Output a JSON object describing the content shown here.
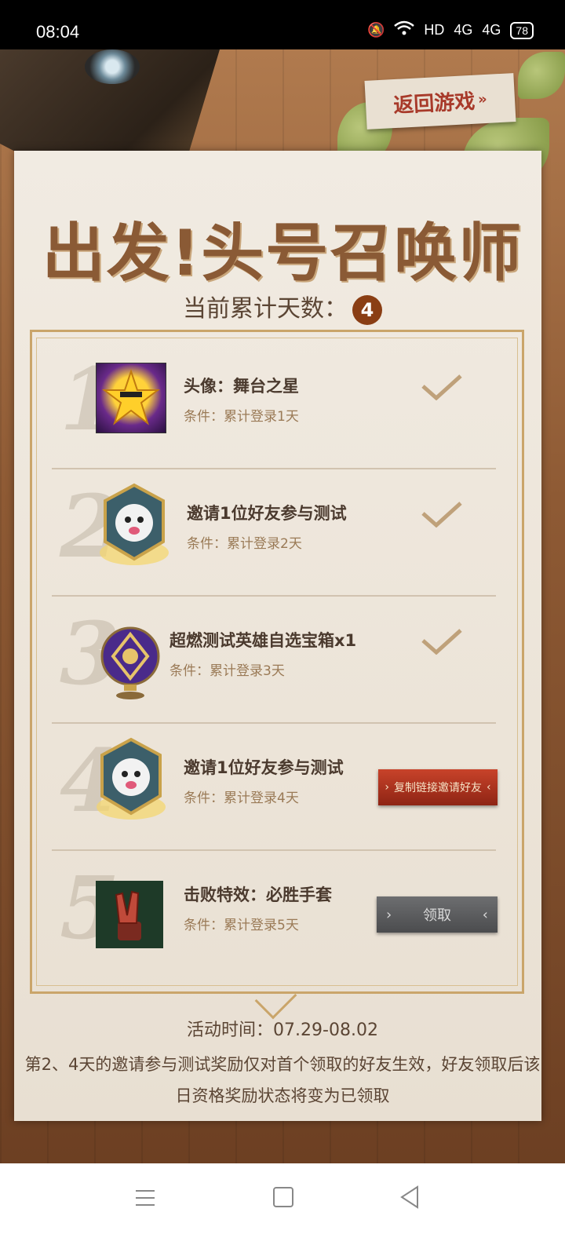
{
  "status_bar": {
    "time": "08:04",
    "network_label": "HD",
    "signal_1": "4G",
    "signal_2": "4G",
    "battery": "78"
  },
  "header": {
    "back_button": "返回游戏",
    "title": "出发!头号召唤师",
    "counter_label": "当前累计天数：",
    "counter_value": "4"
  },
  "rewards": [
    {
      "number": "1",
      "title": "头像：舞台之星",
      "condition": "条件：累计登录1天",
      "status": "claimed",
      "icon": "star-avatar-icon"
    },
    {
      "number": "2",
      "title": "邀请1位好友参与测试",
      "condition": "条件：累计登录2天",
      "status": "claimed",
      "icon": "poro-emblem-icon"
    },
    {
      "number": "3",
      "title": "超燃测试英雄自选宝箱x1",
      "condition": "条件：累计登录3天",
      "status": "claimed",
      "icon": "hero-chest-icon"
    },
    {
      "number": "4",
      "title": "邀请1位好友参与测试",
      "condition": "条件：累计登录4天",
      "status": "invite",
      "button": "复制链接邀请好友",
      "icon": "poro-emblem-icon"
    },
    {
      "number": "5",
      "title": "击败特效：必胜手套",
      "condition": "条件：累计登录5天",
      "status": "claim",
      "button": "领取",
      "icon": "victory-glove-icon"
    }
  ],
  "footer": {
    "activity_time": "活动时间：07.29-08.02",
    "notice": "第2、4天的邀请参与测试奖励仅对首个领取的好友生效，好友领取后该日资格奖励状态将变为已领取"
  },
  "colors": {
    "title": "#8a5a35",
    "badge": "#8a3e14",
    "invite_button": "#c8432a",
    "claim_button": "#6d6e70",
    "check": "#bfa17a"
  }
}
